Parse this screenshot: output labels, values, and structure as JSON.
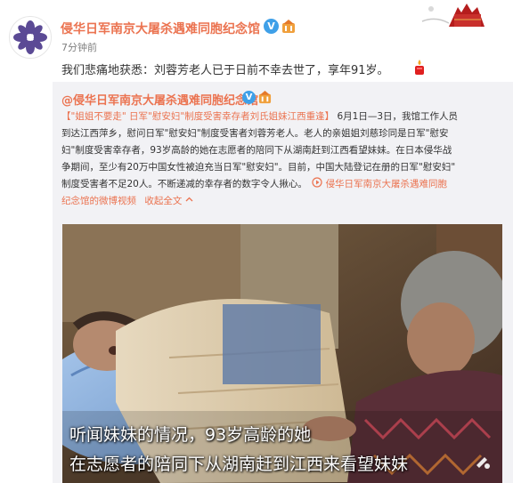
{
  "post": {
    "author": "侵华日军南京大屠杀遇难同胞纪念馆",
    "verified_badge": "V",
    "time": "7分钟前",
    "text": "我们悲痛地获悉：刘蓉芳老人已于日前不幸去世了，享年91岁。"
  },
  "repost": {
    "author": "@侵华日军南京大屠杀遇难同胞纪念馆",
    "verified_badge": "V",
    "hashtag": "【\"姐姐不要走\" 日军\"慰安妇\"制度受害幸存者刘氏姐妹江西重逢】",
    "body_1": "6月1日—3日，我馆工作人员",
    "body_2": "到达江西萍乡，慰问日军\"慰安妇\"制度受害者刘蓉芳老人。老人的亲姐姐刘慈珍同是日军\"慰安",
    "body_3": "妇\"制度受害幸存者，93岁高龄的她在志愿者的陪同下从湖南赶到江西看望妹妹。在日本侵华战",
    "body_4": "争期间，至少有20万中国女性被迫充当日军\"慰安妇\"。目前，中国大陆登记在册的日军\"慰安妇\"",
    "body_5": "制度受害者不足20人。不断递减的幸存者的数字令人揪心。",
    "video_link_a": "侵华日军南京大屠杀遇难同胞",
    "video_link_b": "纪念馆的微博视频",
    "collapse": "收起全文",
    "subtitle_1": "听闻妹妹的情况，93岁高龄的她",
    "subtitle_2": "在志愿者的陪同下从湖南赶到江西来看望妹妹"
  },
  "colors": {
    "accent": "#eb7350",
    "verified": "#3fa0e8",
    "repost_bg": "#f2f2f5",
    "avatar_flower": "#5b4a95"
  }
}
